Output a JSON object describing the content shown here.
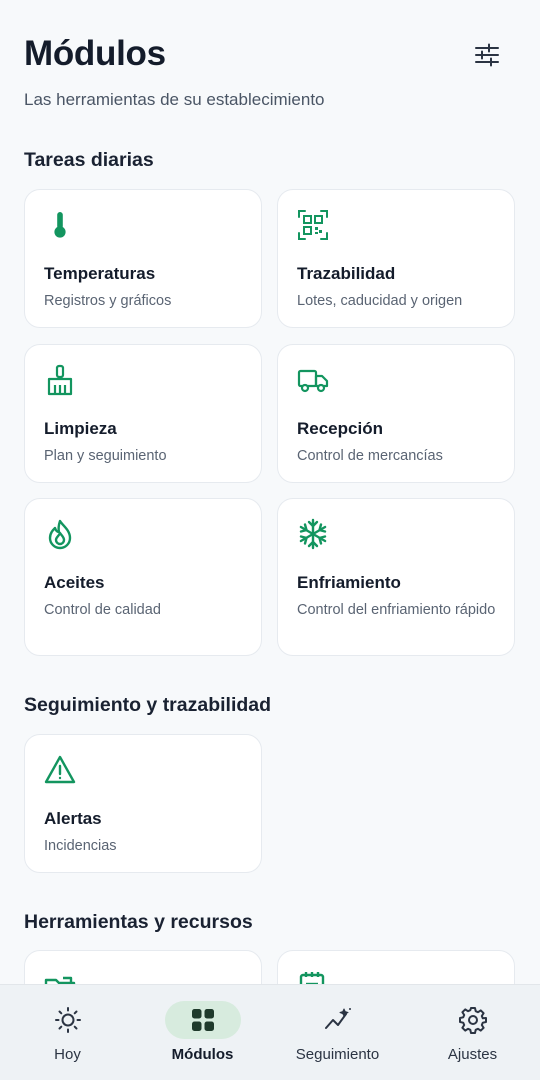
{
  "header": {
    "title": "Módulos",
    "subtitle": "Las herramientas de su establecimiento",
    "filter_icon": "sliders-icon"
  },
  "sections": [
    {
      "title": "Tareas diarias",
      "cards": [
        {
          "name": "Temperaturas",
          "desc": "Registros y gráficos",
          "icon": "thermometer-icon"
        },
        {
          "name": "Trazabilidad",
          "desc": "Lotes, caducidad y origen",
          "icon": "qr-code-icon"
        },
        {
          "name": "Limpieza",
          "desc": "Plan y seguimiento",
          "icon": "broom-icon"
        },
        {
          "name": "Recepción",
          "desc": "Control de mercancías",
          "icon": "truck-icon"
        },
        {
          "name": "Aceites",
          "desc": "Control de calidad",
          "icon": "oil-drop-icon"
        },
        {
          "name": "Enfriamiento",
          "desc": "Control del enfriamiento rápido",
          "icon": "snowflake-icon"
        }
      ]
    },
    {
      "title": "Seguimiento y trazabilidad",
      "cards": [
        {
          "name": "Alertas",
          "desc": "Incidencias",
          "icon": "warning-triangle-icon"
        }
      ]
    },
    {
      "title": "Herramientas y recursos",
      "cards": [
        {
          "name": "",
          "desc": "",
          "icon": "folder-icon"
        },
        {
          "name": "",
          "desc": "",
          "icon": "calendar-list-icon"
        }
      ]
    }
  ],
  "nav": [
    {
      "label": "Hoy",
      "icon": "sun-icon",
      "active": false
    },
    {
      "label": "Módulos",
      "icon": "grid-icon",
      "active": true
    },
    {
      "label": "Seguimiento",
      "icon": "trend-chart-icon",
      "active": false
    },
    {
      "label": "Ajustes",
      "icon": "gear-icon",
      "active": false
    }
  ],
  "colors": {
    "accent": "#13955f",
    "background": "#f7f9fb",
    "card": "#ffffff",
    "nav_background": "#eef2f5",
    "nav_active_pill": "#d7ebde",
    "text_primary": "#141c2b",
    "text_secondary": "#5a6473"
  }
}
